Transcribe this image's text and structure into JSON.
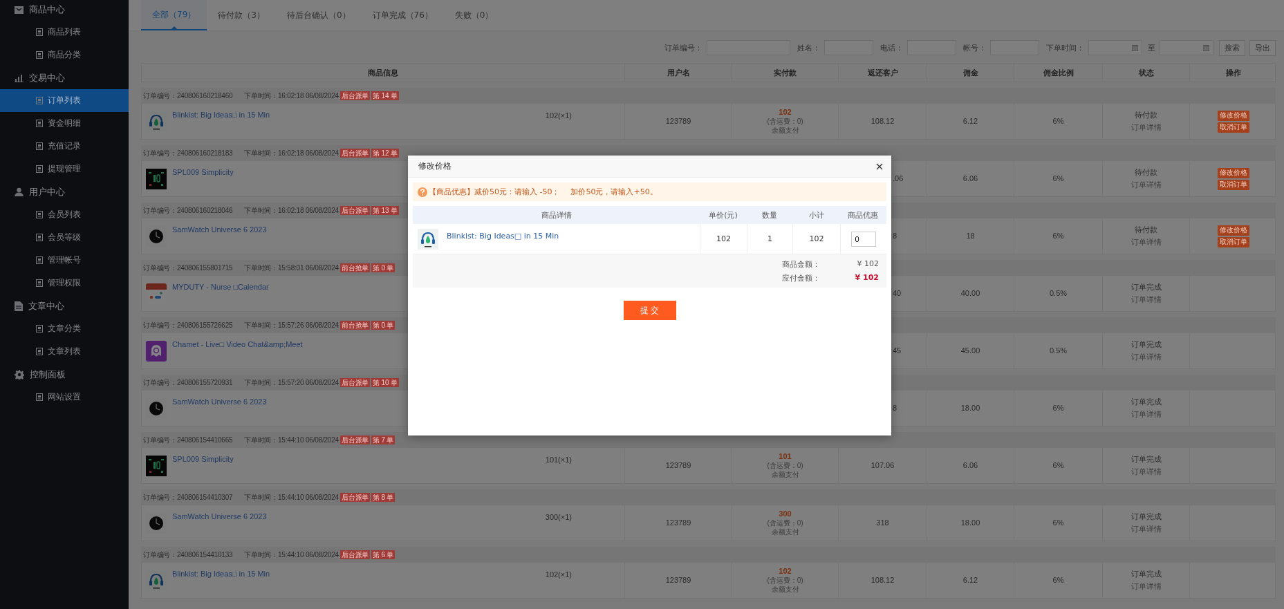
{
  "sidebar": {
    "groups": [
      {
        "label": "商品中心",
        "kind": "box",
        "children": [
          {
            "label": "商品列表",
            "selected": false
          },
          {
            "label": "商品分类",
            "selected": false
          }
        ]
      },
      {
        "label": "交易中心",
        "kind": "chart",
        "children": [
          {
            "label": "订单列表",
            "selected": true
          },
          {
            "label": "资金明细",
            "selected": false
          },
          {
            "label": "充值记录",
            "selected": false
          },
          {
            "label": "提现管理",
            "selected": false
          }
        ]
      },
      {
        "label": "用户中心",
        "kind": "user",
        "children": [
          {
            "label": "会员列表",
            "selected": false
          },
          {
            "label": "会员等级",
            "selected": false
          },
          {
            "label": "管理帐号",
            "selected": false
          },
          {
            "label": "管理权限",
            "selected": false
          }
        ]
      },
      {
        "label": "文章中心",
        "kind": "doc",
        "children": [
          {
            "label": "文章分类",
            "selected": false
          },
          {
            "label": "文章列表",
            "selected": false
          }
        ]
      },
      {
        "label": "控制面板",
        "kind": "gear",
        "children": [
          {
            "label": "网站设置",
            "selected": false
          }
        ]
      }
    ]
  },
  "tabs": [
    {
      "label": "全部（79）",
      "selected": true
    },
    {
      "label": "待付款（3）",
      "selected": false
    },
    {
      "label": "待后台确认（0）",
      "selected": false
    },
    {
      "label": "订单完成（76）",
      "selected": false
    },
    {
      "label": "失败（0）",
      "selected": false
    }
  ],
  "filters": {
    "fields": [
      {
        "label": "订单编号：",
        "kind": "text"
      },
      {
        "label": "姓名：",
        "kind": "text"
      },
      {
        "label": "电话：",
        "kind": "text"
      },
      {
        "label": "帐号：",
        "kind": "text"
      },
      {
        "label": "下单时间：",
        "kind": "date"
      },
      {
        "label": "至",
        "kind": "date"
      }
    ],
    "buttons": [
      "搜索",
      "导出"
    ]
  },
  "table": {
    "columns": [
      "商品信息",
      "用户名",
      "实付款",
      "返还客户",
      "佣金",
      "佣金比例",
      "状态",
      "操作"
    ],
    "orders": [
      {
        "order_no": "订单编号：240806160218460",
        "time": "下单时间：16:02:18 06/08/2024",
        "tags": [
          "后台派单",
          "第 14 单"
        ],
        "product": {
          "name": "Blinkist: Big Ideas□ in 15 Min",
          "kind": "headphones",
          "quantity": "102(×1)"
        },
        "user": "123789",
        "paid": {
          "amount": "102",
          "shipping": "(含运费：0)",
          "method": "余额支付"
        },
        "refund": "108.12",
        "partly_covered": false,
        "commission": "6.12",
        "rate": "6%",
        "status": "待付款",
        "detail_link": "订单详情",
        "actions": [
          "修改价格",
          "取消订单"
        ]
      },
      {
        "order_no": "订单编号：240806160218183",
        "time": "下单时间：16:02:18 06/08/2024",
        "tags": [
          "后台派单",
          "第 12 单"
        ],
        "product": {
          "name": "SPL009 Simplicity",
          "kind": "watch-digital"
        },
        "refund": ".06",
        "partly_covered": true,
        "commission": "6.06",
        "rate": "6%",
        "status": "待付款",
        "detail_link": "订单详情",
        "actions": [
          "修改价格",
          "取消订单"
        ]
      },
      {
        "order_no": "订单编号：240806160218046",
        "time": "下单时间：16:02:18 06/08/2024",
        "tags": [
          "后台派单",
          "第 13 单"
        ],
        "product": {
          "name": "SamWatch Universe 6 2023",
          "kind": "watch-round"
        },
        "refund": "8",
        "partly_covered": true,
        "commission": "18",
        "rate": "6%",
        "status": "待付款",
        "detail_link": "订单详情",
        "actions": [
          "修改价格",
          "取消订单"
        ]
      },
      {
        "order_no": "订单编号：240806155801715",
        "time": "下单时间：15:58:01 06/08/2024",
        "tags": [
          "前台抢单",
          "第 0 单"
        ],
        "product": {
          "name": "MYDUTY - Nurse □Calendar",
          "kind": "calendar"
        },
        "refund": "40",
        "partly_covered": true,
        "commission": "40.00",
        "rate": "0.5%",
        "status": "订单完成",
        "detail_link": "订单详情"
      },
      {
        "order_no": "订单编号：240806155726625",
        "time": "下单时间：15:57:26 06/08/2024",
        "tags": [
          "前台抢单",
          "第 0 单"
        ],
        "product": {
          "name": "Chamet - Live□ Video Chat&amp;Meet",
          "kind": "ghost"
        },
        "refund": "45",
        "partly_covered": true,
        "commission": "45.00",
        "rate": "0.5%",
        "status": "订单完成",
        "detail_link": "订单详情"
      },
      {
        "order_no": "订单编号：240806155720931",
        "time": "下单时间：15:57:20 06/08/2024",
        "tags": [
          "后台派单",
          "第 10 单"
        ],
        "product": {
          "name": "SamWatch Universe 6 2023",
          "kind": "watch-round"
        },
        "refund": "8",
        "partly_covered": true,
        "commission": "18.00",
        "rate": "6%",
        "status": "订单完成",
        "detail_link": "订单详情"
      },
      {
        "order_no": "订单编号：240806154410665",
        "time": "下单时间：15:44:10 06/08/2024",
        "tags": [
          "后台派单",
          "第 7 单"
        ],
        "product": {
          "name": "SPL009 Simplicity",
          "kind": "watch-digital",
          "quantity": "101(×1)"
        },
        "user": "123789",
        "paid": {
          "amount": "101",
          "shipping": "(含运费：0)",
          "method": "余额支付"
        },
        "refund": "107.06",
        "partly_covered": false,
        "commission": "6.06",
        "rate": "6%",
        "status": "订单完成",
        "detail_link": "订单详情"
      },
      {
        "order_no": "订单编号：240806154410307",
        "time": "下单时间：15:44:10 06/08/2024",
        "tags": [
          "后台派单",
          "第 8 单"
        ],
        "product": {
          "name": "SamWatch Universe 6 2023",
          "kind": "watch-round",
          "quantity": "300(×1)"
        },
        "user": "123789",
        "paid": {
          "amount": "300",
          "shipping": "(含运费：0)",
          "method": "余额支付"
        },
        "refund": "318",
        "partly_covered": false,
        "commission": "18.00",
        "rate": "6%",
        "status": "订单完成",
        "detail_link": "订单详情"
      },
      {
        "order_no": "订单编号：240806154410133",
        "time": "下单时间：15:44:10 06/08/2024",
        "tags": [
          "后台派单",
          "第 6 单"
        ],
        "product": {
          "name": "Blinkist: Big Ideas□ in 15 Min",
          "kind": "headphones",
          "quantity": "102(×1)"
        },
        "user": "123789",
        "paid": {
          "amount": "102",
          "shipping": "(含运费：0)",
          "method": "余额支付"
        },
        "refund": "108.12",
        "partly_covered": false,
        "commission": "6.12",
        "rate": "6%",
        "status": "订单完成",
        "detail_link": "订单详情"
      }
    ]
  },
  "modal": {
    "title": "修改价格",
    "notice": [
      "【商品优惠】减价50元：请输入 -50；",
      "加价50元，请输入+50。"
    ],
    "columns": [
      "商品详情",
      "单价(元)",
      "数量",
      "小计",
      "商品优惠"
    ],
    "items": [
      {
        "name": "Blinkist: Big Ideas□ in 15 Min",
        "kind": "headphones",
        "unit_price": "102",
        "quantity": "1",
        "subtotal": "102",
        "discount": "0"
      }
    ],
    "summary": [
      {
        "label": "商品金额：",
        "value": "¥ 102",
        "emphasis": false
      },
      {
        "label": "应付金额：",
        "value": "¥ 102",
        "emphasis": true
      }
    ],
    "submit": "提 交"
  }
}
